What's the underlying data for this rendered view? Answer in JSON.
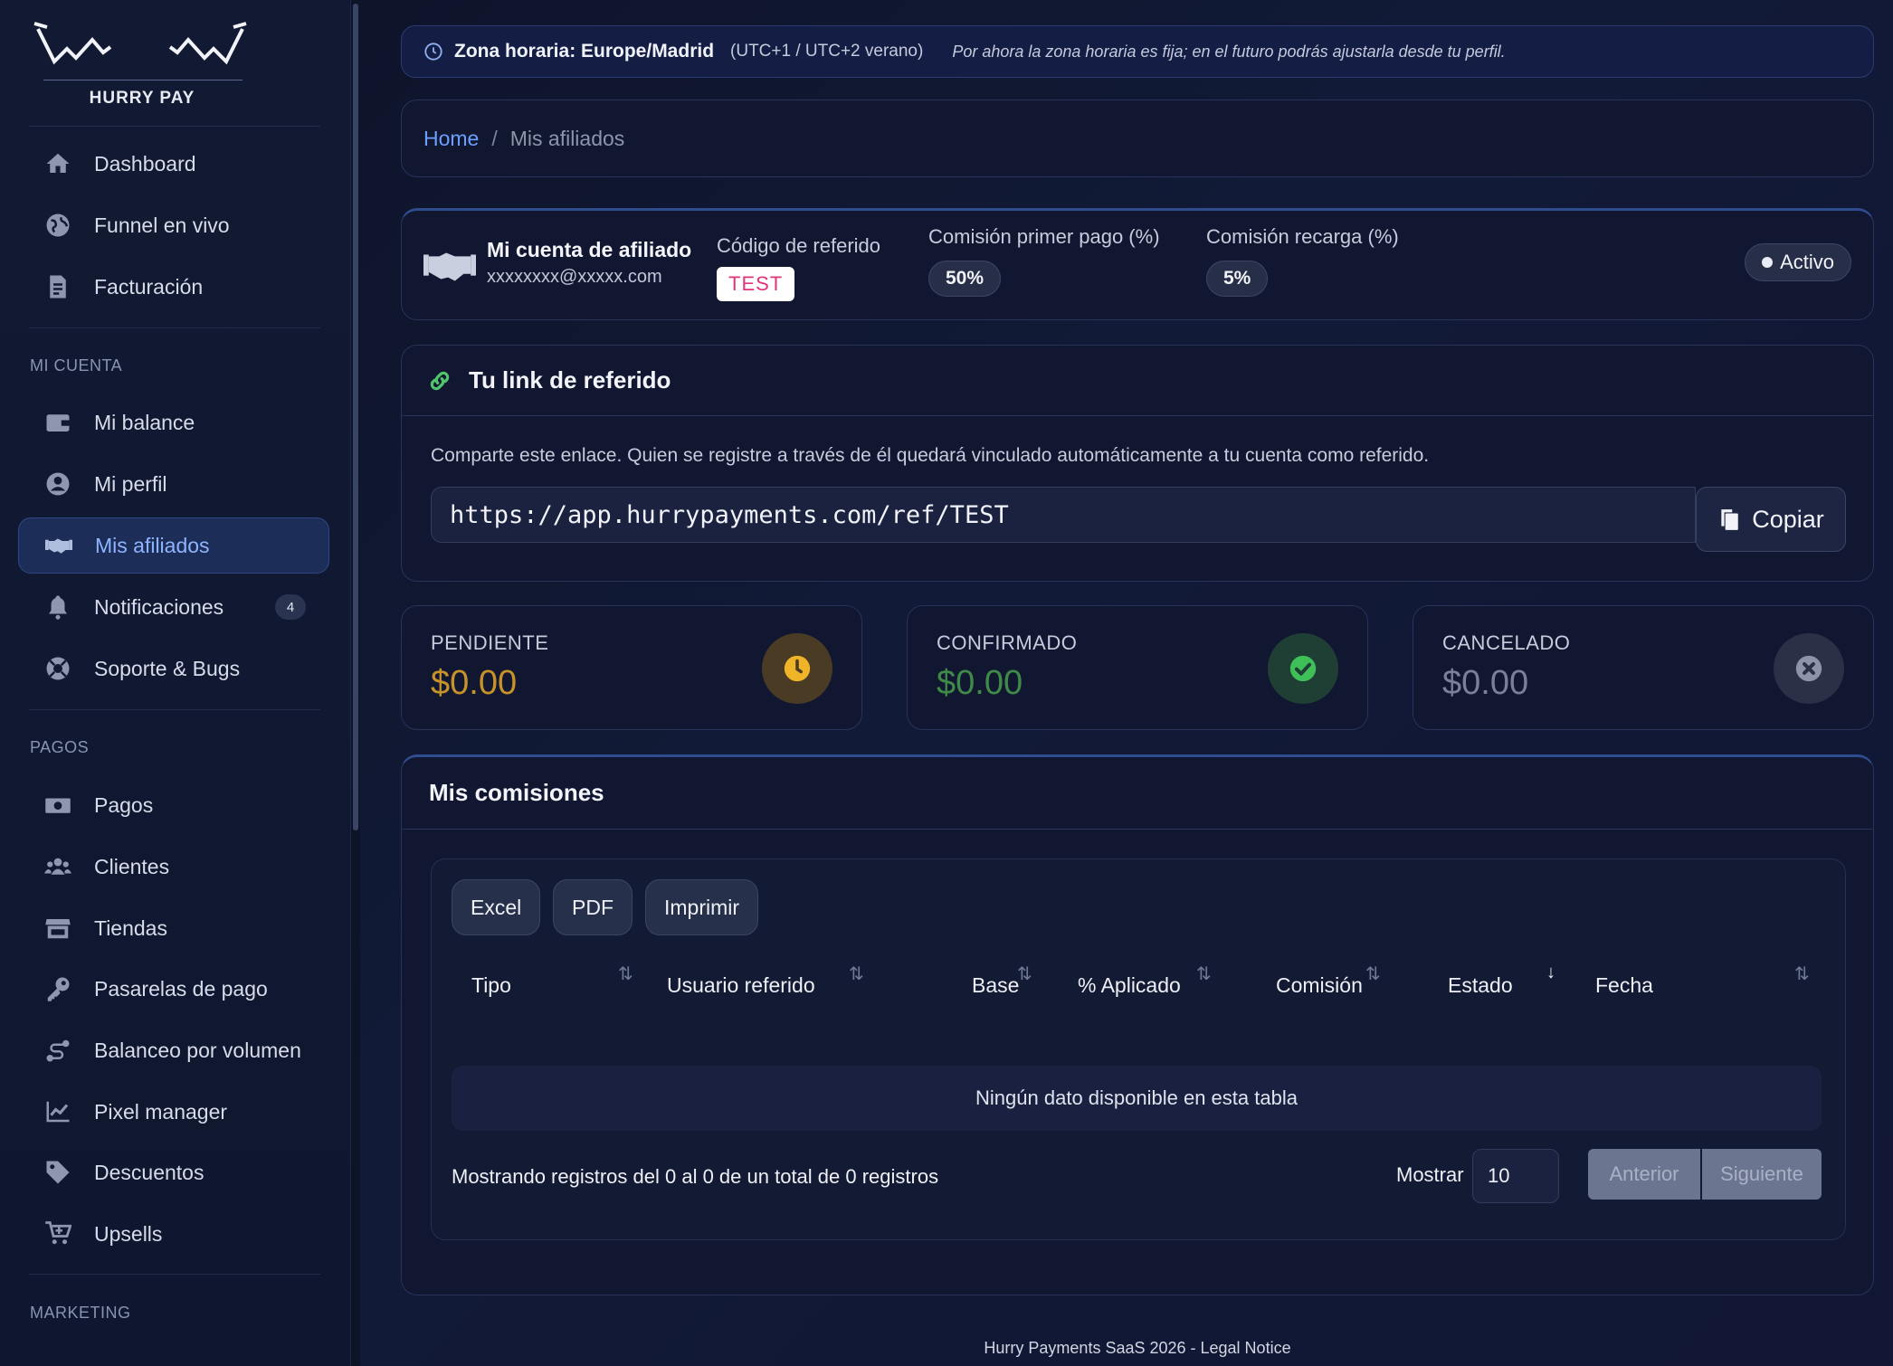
{
  "brand": {
    "name": "HURRY PAY"
  },
  "sidebar": {
    "top_items": [
      {
        "label": "Dashboard",
        "icon": "home-icon"
      },
      {
        "label": "Funnel en vivo",
        "icon": "globe-icon"
      },
      {
        "label": "Facturación",
        "icon": "invoice-icon"
      }
    ],
    "section_account": "MI CUENTA",
    "account_items": [
      {
        "label": "Mi balance",
        "icon": "wallet-icon"
      },
      {
        "label": "Mi perfil",
        "icon": "user-circle-icon"
      },
      {
        "label": "Mis afiliados",
        "icon": "handshake-icon",
        "active": true
      },
      {
        "label": "Notificaciones",
        "icon": "bell-icon",
        "badge": "4"
      },
      {
        "label": "Soporte & Bugs",
        "icon": "lifebuoy-icon"
      }
    ],
    "section_payments": "PAGOS",
    "payment_items": [
      {
        "label": "Pagos",
        "icon": "money-icon"
      },
      {
        "label": "Clientes",
        "icon": "users-icon"
      },
      {
        "label": "Tiendas",
        "icon": "store-icon"
      },
      {
        "label": "Pasarelas de pago",
        "icon": "key-icon"
      },
      {
        "label": "Balanceo por volumen",
        "icon": "route-icon"
      },
      {
        "label": "Pixel manager",
        "icon": "chart-line-icon"
      },
      {
        "label": "Descuentos",
        "icon": "tag-icon"
      },
      {
        "label": "Upsells",
        "icon": "cart-plus-icon"
      }
    ],
    "section_marketing": "MARKETING"
  },
  "timezone": {
    "title": "Zona horaria: Europe/Madrid",
    "utc": "(UTC+1 / UTC+2 verano)",
    "note": "Por ahora la zona horaria es fija; en el futuro podrás ajustarla desde tu perfil."
  },
  "breadcrumb": {
    "home": "Home",
    "separator": "/",
    "current": "Mis afiliados"
  },
  "affiliate": {
    "title": "Mi cuenta de afiliado",
    "email": "xxxxxxxx@xxxxx.com",
    "code_label": "Código de referido",
    "code": "TEST",
    "first_label": "Comisión primer pago (%)",
    "first_value": "50%",
    "recharge_label": "Comisión recarga (%)",
    "recharge_value": "5%",
    "status": "Activo"
  },
  "referral": {
    "title": "Tu link de referido",
    "description": "Comparte este enlace. Quien se registre a través de él quedará vinculado automáticamente a tu cuenta como referido.",
    "link": "https://app.hurrypayments.com/ref/TEST",
    "copy_label": "Copiar"
  },
  "stats": {
    "pending": {
      "label": "PENDIENTE",
      "value": "$0.00",
      "color": "#c8922a"
    },
    "confirmed": {
      "label": "CONFIRMADO",
      "value": "$0.00",
      "color": "#3f8a47"
    },
    "cancelled": {
      "label": "CANCELADO",
      "value": "$0.00",
      "color": "#7a8096"
    }
  },
  "commissions": {
    "title": "Mis comisiones",
    "buttons": [
      "Excel",
      "PDF",
      "Imprimir"
    ],
    "columns": [
      "Tipo",
      "Usuario referido",
      "Base",
      "% Aplicado",
      "Comisión",
      "Estado",
      "Fecha"
    ],
    "empty": "Ningún dato disponible en esta tabla",
    "info": "Mostrando registros del 0 al 0 de un total de 0 registros",
    "show_label": "Mostrar",
    "page_size": "10",
    "prev": "Anterior",
    "next": "Siguiente"
  },
  "footer": "Hurry Payments SaaS 2026 - Legal Notice"
}
